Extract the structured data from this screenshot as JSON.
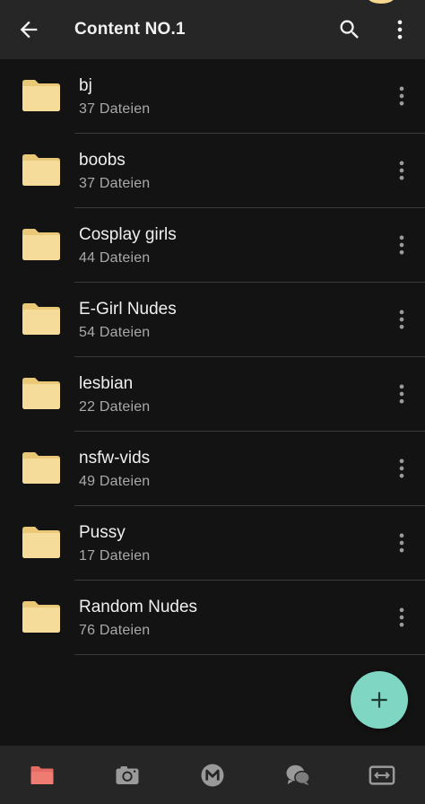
{
  "header": {
    "title": "Content NO.1",
    "back_icon": "arrow-left-icon",
    "search_icon": "search-icon",
    "more_icon": "more-vertical-icon"
  },
  "folders": [
    {
      "name": "bj",
      "count": "37 Dateien"
    },
    {
      "name": "boobs",
      "count": "37 Dateien"
    },
    {
      "name": "Cosplay girls",
      "count": "44 Dateien"
    },
    {
      "name": "E-Girl Nudes",
      "count": "54 Dateien"
    },
    {
      "name": "lesbian",
      "count": "22 Dateien"
    },
    {
      "name": "nsfw-vids",
      "count": "49 Dateien"
    },
    {
      "name": "Pussy",
      "count": "17 Dateien"
    },
    {
      "name": "Random Nudes",
      "count": "76 Dateien"
    }
  ],
  "fab": {
    "icon": "plus-icon",
    "color": "#7fd6c2"
  },
  "bottom_nav": [
    {
      "icon": "folder-icon",
      "active": true
    },
    {
      "icon": "camera-icon",
      "active": false
    },
    {
      "icon": "mega-icon",
      "active": false
    },
    {
      "icon": "chat-icon",
      "active": false
    },
    {
      "icon": "transfer-icon",
      "active": false
    }
  ],
  "colors": {
    "background": "#131313",
    "toolbar": "#262626",
    "folder": "#f6dc9a",
    "accent": "#7fd6c2",
    "active_nav": "#e36b63"
  }
}
